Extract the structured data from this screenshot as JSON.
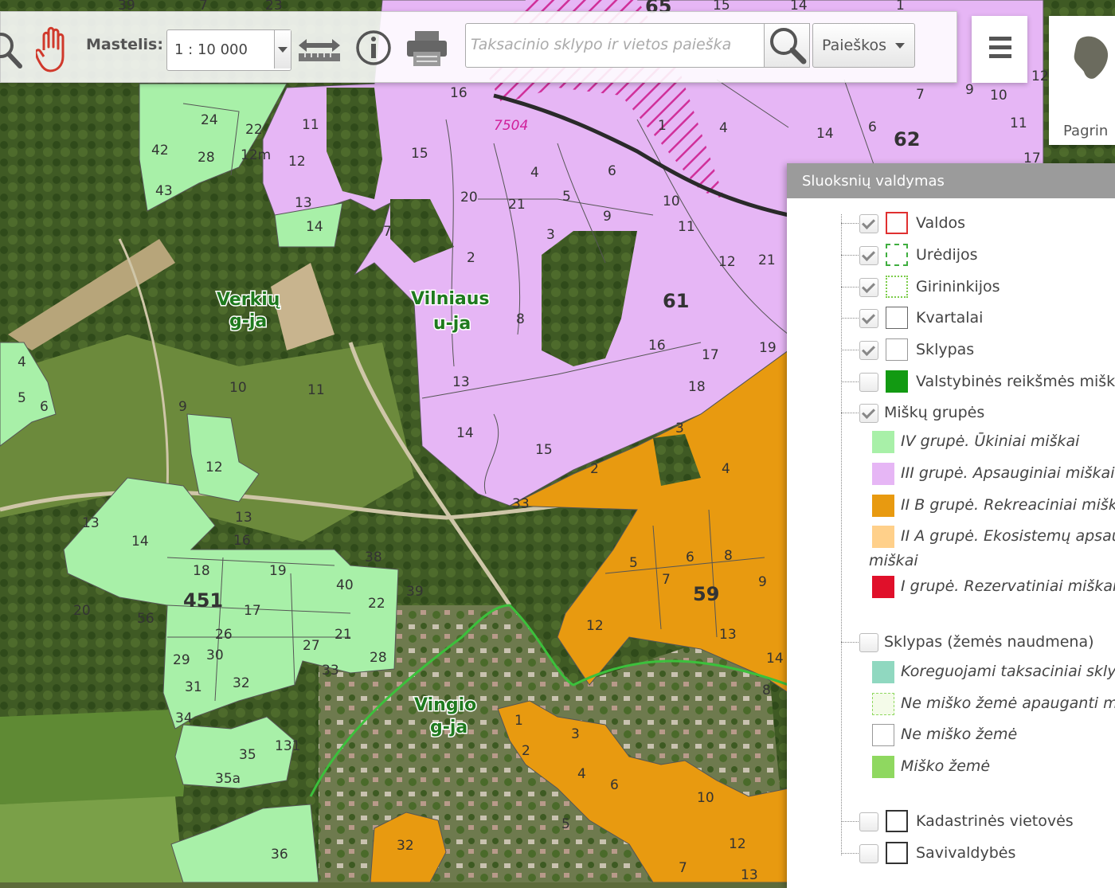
{
  "toolbar": {
    "scale_label": "Mastelis:",
    "scale_value": "1 : 10 000",
    "search_placeholder": "Taksacinio sklypo ir vietos paieška",
    "searches_label": "Paieškos"
  },
  "home": {
    "label": "Pagrin"
  },
  "map": {
    "labels": {
      "vilniaus_1": "Vilniaus",
      "vilniaus_2": "u-ja",
      "verkiu_1": "Verkių",
      "verkiu_2": "g-ja",
      "vingio_1": "Vingio",
      "vingio_2": "g-ja",
      "road": "7504"
    },
    "quarters": {
      "q65": "65",
      "q62": "62",
      "q61": "61",
      "q59": "59",
      "q451": "451"
    },
    "colors": {
      "group_iv": "#a8f0a8",
      "group_iii": "#e6b6f5",
      "group_iib": "#e89a10",
      "group_iia": "#ffd08a",
      "group_i": "#e0102a"
    }
  },
  "layers_panel": {
    "title": "Sluoksnių valdymas",
    "layers": [
      {
        "label": "Valdos",
        "checked": true
      },
      {
        "label": "Urėdijos",
        "checked": true
      },
      {
        "label": "Girininkijos",
        "checked": true
      },
      {
        "label": "Kvartalai",
        "checked": true
      },
      {
        "label": "Sklypas",
        "checked": true
      },
      {
        "label": "Valstybinės reikšmės miškai",
        "checked": false
      },
      {
        "label": "Miškų grupės",
        "checked": true
      },
      {
        "label": "Sklypas (žemės naudmena)",
        "checked": false
      },
      {
        "label": "Kadastrinės vietovės",
        "checked": false
      },
      {
        "label": "Savivaldybės",
        "checked": false
      }
    ],
    "forest_groups": [
      {
        "label": "IV grupė. Ūkiniai miškai",
        "color": "#a8f0a8"
      },
      {
        "label": "III grupė. Apsauginiai miškai",
        "color": "#e6b6f5"
      },
      {
        "label": "II B grupė. Rekreaciniai miškai",
        "color": "#e89a10"
      },
      {
        "label": "II A grupė. Ekosistemų apsaugos",
        "continuation": "miškai",
        "color": "#ffd08a"
      },
      {
        "label": "I grupė. Rezervatiniai miškai",
        "color": "#e0102a"
      }
    ],
    "land_use": [
      {
        "label": "Koreguojami taksaciniai sklypai",
        "color": "#90d8c0"
      },
      {
        "label": "Ne miško žemė apauganti mišku",
        "color": "#ffffff"
      },
      {
        "label": "Ne miško žemė",
        "color": "#ffffff"
      },
      {
        "label": "Miško žemė",
        "color": "#8fd860"
      }
    ]
  }
}
